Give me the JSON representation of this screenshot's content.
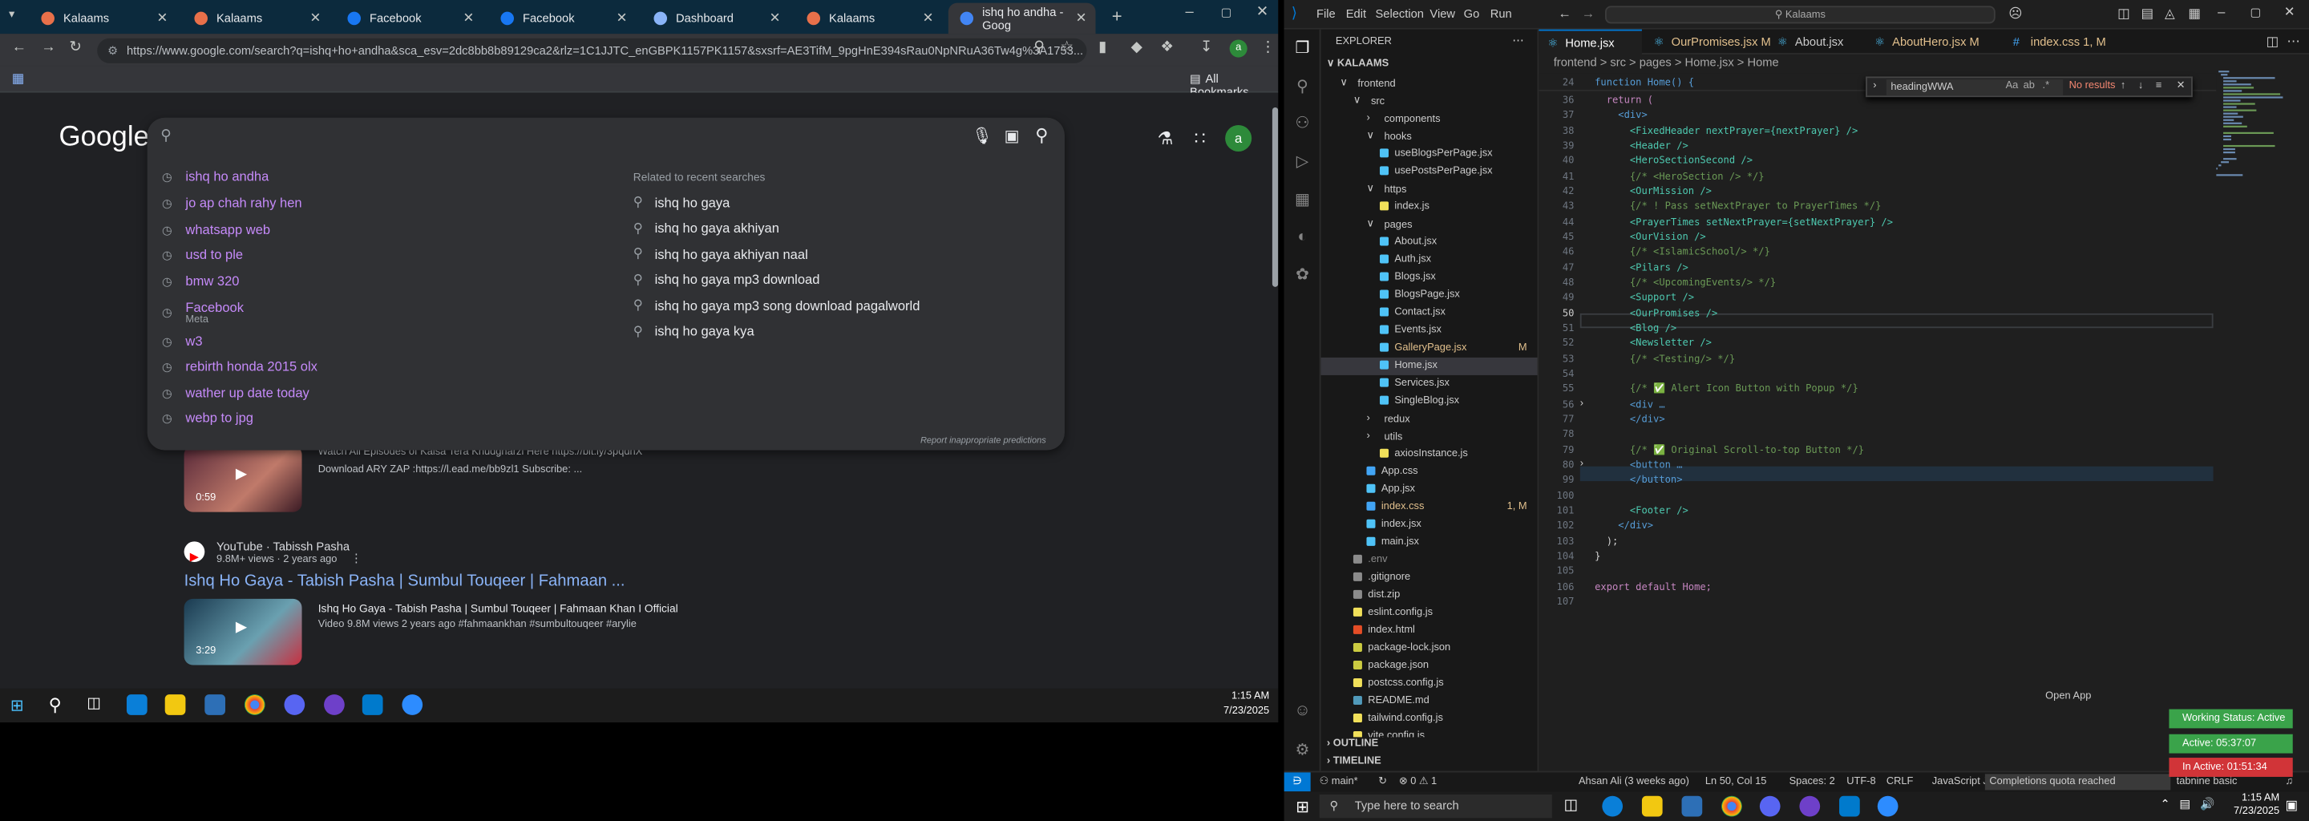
{
  "chrome": {
    "tabs": [
      {
        "title": "Kalaams",
        "icon": "kalaams-favicon-icon",
        "color": "#e8704a"
      },
      {
        "title": "Kalaams",
        "icon": "kalaams-favicon-icon",
        "color": "#e8704a"
      },
      {
        "title": "Facebook",
        "icon": "facebook-icon",
        "color": "#1877f2"
      },
      {
        "title": "Facebook",
        "icon": "facebook-icon",
        "color": "#1877f2"
      },
      {
        "title": "Dashboard",
        "icon": "globe-icon",
        "color": "#8ab4f8"
      },
      {
        "title": "Kalaams",
        "icon": "kalaams-favicon-icon",
        "color": "#e8704a"
      },
      {
        "title": "ishq ho andha - Goog",
        "icon": "google-icon",
        "color": "#4285f4"
      }
    ],
    "url": "https://www.google.com/search?q=ishq+ho+andha&sca_esv=2dc8bb8b89129ca2&rlz=1C1JJTC_enGBPK1157PK1157&sxsrf=AE3TifM_9pgHnE394sRau0NpNRuA36Tw4g%3A1753...",
    "all_bookmarks": "All Bookmarks",
    "avatar_letter": "a",
    "google_logo": "Google"
  },
  "search": {
    "suggestions": [
      {
        "text": "ishq ho andha",
        "sub": ""
      },
      {
        "text": "jo ap chah rahy hen",
        "sub": ""
      },
      {
        "text": "whatsapp web",
        "sub": ""
      },
      {
        "text": "usd to ple",
        "sub": ""
      },
      {
        "text": "bmw 320",
        "sub": ""
      },
      {
        "text": "Facebook",
        "sub": "Meta"
      },
      {
        "text": "w3",
        "sub": ""
      },
      {
        "text": "rebirth honda 2015 olx",
        "sub": ""
      },
      {
        "text": "wather up date today",
        "sub": ""
      },
      {
        "text": "webp to jpg",
        "sub": ""
      }
    ],
    "related_heading": "Related to recent searches",
    "related": [
      "ishq ho gaya",
      "ishq ho gaya akhiyan",
      "ishq ho gaya akhiyan naal",
      "ishq ho gaya mp3 download",
      "ishq ho gaya mp3 song download pagalworld",
      "ishq ho gaya kya"
    ],
    "report": "Report inappropriate predictions"
  },
  "results": {
    "partial_text": "Watch All Episodes of Kaisa Tera Khudgharzi Here  https://bit.ly/3pqdnX",
    "partial_desc": "Download ARY ZAP :https://l.ead.me/bb9zl1 Subscribe: ...",
    "duration1": "0:59",
    "source": "YouTube · Tabissh Pasha",
    "meta": "9.8M+ views · 2 years ago",
    "title": "Ishq Ho Gaya - Tabish Pasha | Sumbul Touqeer | Fahmaan ...",
    "desc": "Ishq Ho Gaya - Tabish Pasha | Sumbul Touqeer | Fahmaan Khan I Official",
    "desc2": "Video 9.8M views 2 years ago #fahmaankhan #sumbultouqeer #arylie",
    "duration2": "3:29"
  },
  "taskbar_left": {
    "time": "1:15 AM",
    "date": "7/23/2025"
  },
  "vscode": {
    "menu": [
      "File",
      "Edit",
      "Selection",
      "View",
      "Go",
      "Run"
    ],
    "search_placeholder": "Kalaams",
    "explorer_title": "EXPLORER",
    "root": "KALAAMS",
    "tree": [
      {
        "label": "frontend",
        "indent": 1,
        "type": "folder",
        "status": "",
        "color": "#cccccc"
      },
      {
        "label": "src",
        "indent": 2,
        "type": "folder",
        "status": "",
        "color": "#cccccc"
      },
      {
        "label": "components",
        "indent": 3,
        "type": "folder",
        "status": "",
        "color": "#cccccc"
      },
      {
        "label": "hooks",
        "indent": 3,
        "type": "folder",
        "status": "",
        "color": "#cccccc"
      },
      {
        "label": "useBlogsPerPage.jsx",
        "indent": 4,
        "type": "file",
        "status": "",
        "color": "#cccccc"
      },
      {
        "label": "usePostsPerPage.jsx",
        "indent": 4,
        "type": "file",
        "status": "",
        "color": "#cccccc"
      },
      {
        "label": "https",
        "indent": 3,
        "type": "folder",
        "status": "",
        "color": "#cccccc"
      },
      {
        "label": "index.js",
        "indent": 4,
        "type": "file",
        "status": "",
        "color": "#cccccc"
      },
      {
        "label": "pages",
        "indent": 3,
        "type": "folder",
        "status": "",
        "color": "#cccccc"
      },
      {
        "label": "About.jsx",
        "indent": 4,
        "type": "file",
        "status": "",
        "color": "#cccccc"
      },
      {
        "label": "Auth.jsx",
        "indent": 4,
        "type": "file",
        "status": "",
        "color": "#cccccc"
      },
      {
        "label": "Blogs.jsx",
        "indent": 4,
        "type": "file",
        "status": "",
        "color": "#cccccc"
      },
      {
        "label": "BlogsPage.jsx",
        "indent": 4,
        "type": "file",
        "status": "",
        "color": "#cccccc"
      },
      {
        "label": "Contact.jsx",
        "indent": 4,
        "type": "file",
        "status": "",
        "color": "#cccccc"
      },
      {
        "label": "Events.jsx",
        "indent": 4,
        "type": "file",
        "status": "",
        "color": "#cccccc"
      },
      {
        "label": "GalleryPage.jsx",
        "indent": 4,
        "type": "file",
        "status": "M",
        "color": "#e2c08d"
      },
      {
        "label": "Home.jsx",
        "indent": 4,
        "type": "file",
        "status": "",
        "color": "#cccccc"
      },
      {
        "label": "Services.jsx",
        "indent": 4,
        "type": "file",
        "status": "",
        "color": "#cccccc"
      },
      {
        "label": "SingleBlog.jsx",
        "indent": 4,
        "type": "file",
        "status": "",
        "color": "#cccccc"
      },
      {
        "label": "redux",
        "indent": 3,
        "type": "folder",
        "status": "",
        "color": "#cccccc"
      },
      {
        "label": "utils",
        "indent": 3,
        "type": "folder",
        "status": "",
        "color": "#cccccc"
      },
      {
        "label": "axiosInstance.js",
        "indent": 4,
        "type": "file",
        "status": "",
        "color": "#cccccc"
      },
      {
        "label": "App.css",
        "indent": 3,
        "type": "file",
        "status": "",
        "color": "#cccccc"
      },
      {
        "label": "App.jsx",
        "indent": 3,
        "type": "file",
        "status": "",
        "color": "#cccccc"
      },
      {
        "label": "index.css",
        "indent": 3,
        "type": "file",
        "status": "1, M",
        "color": "#e2c08d"
      },
      {
        "label": "index.jsx",
        "indent": 3,
        "type": "file",
        "status": "",
        "color": "#cccccc"
      },
      {
        "label": "main.jsx",
        "indent": 3,
        "type": "file",
        "status": "",
        "color": "#cccccc"
      },
      {
        "label": ".env",
        "indent": 2,
        "type": "file",
        "status": "",
        "color": "#8b8b8b"
      },
      {
        "label": ".gitignore",
        "indent": 2,
        "type": "file",
        "status": "",
        "color": "#cccccc"
      },
      {
        "label": "dist.zip",
        "indent": 2,
        "type": "file",
        "status": "",
        "color": "#cccccc"
      },
      {
        "label": "eslint.config.js",
        "indent": 2,
        "type": "file",
        "status": "",
        "color": "#cccccc"
      },
      {
        "label": "index.html",
        "indent": 2,
        "type": "file",
        "status": "",
        "color": "#cccccc"
      },
      {
        "label": "package-lock.json",
        "indent": 2,
        "type": "file",
        "status": "",
        "color": "#cccccc"
      },
      {
        "label": "package.json",
        "indent": 2,
        "type": "file",
        "status": "",
        "color": "#cccccc"
      },
      {
        "label": "postcss.config.js",
        "indent": 2,
        "type": "file",
        "status": "",
        "color": "#cccccc"
      },
      {
        "label": "README.md",
        "indent": 2,
        "type": "file",
        "status": "",
        "color": "#cccccc"
      },
      {
        "label": "tailwind.config.js",
        "indent": 2,
        "type": "file",
        "status": "",
        "color": "#cccccc"
      },
      {
        "label": "vite.config.js",
        "indent": 2,
        "type": "file",
        "status": "",
        "color": "#cccccc"
      }
    ],
    "outline": "OUTLINE",
    "timeline": "TIMELINE",
    "tabs": [
      {
        "label": "Home.jsx",
        "color": "#ffffff",
        "active": true
      },
      {
        "label": "OurPromises.jsx M",
        "color": "#e2c08d",
        "active": false
      },
      {
        "label": "About.jsx",
        "color": "#cccccc",
        "active": false
      },
      {
        "label": "AboutHero.jsx M",
        "color": "#e2c08d",
        "active": false
      },
      {
        "label": "index.css 1, M",
        "color": "#e2c08d",
        "active": false
      }
    ],
    "breadcrumb": "frontend  >  src  >  pages  >  Home.jsx  >  Home",
    "find_value": "headingWWA",
    "find_result": "No results",
    "sticky": {
      "line": "24",
      "text": "function Home() {"
    },
    "code": [
      {
        "n": "36",
        "t": "  return ("
      },
      {
        "n": "37",
        "t": "    <div>"
      },
      {
        "n": "38",
        "t": "      <FixedHeader nextPrayer={nextPrayer} />"
      },
      {
        "n": "39",
        "t": "      <Header />"
      },
      {
        "n": "40",
        "t": "      <HeroSectionSecond />"
      },
      {
        "n": "41",
        "t": "      {/* <HeroSection /> */}"
      },
      {
        "n": "42",
        "t": "      <OurMission />"
      },
      {
        "n": "43",
        "t": "      {/* ! Pass setNextPrayer to PrayerTimes */}"
      },
      {
        "n": "44",
        "t": "      <PrayerTimes setNextPrayer={setNextPrayer} />"
      },
      {
        "n": "45",
        "t": "      <OurVision />"
      },
      {
        "n": "46",
        "t": "      {/* <IslamicSchool/> */}"
      },
      {
        "n": "47",
        "t": "      <Pilars />"
      },
      {
        "n": "48",
        "t": "      {/* <UpcomingEvents/> */}"
      },
      {
        "n": "49",
        "t": "      <Support />"
      },
      {
        "n": "50",
        "t": "      <OurPromises />"
      },
      {
        "n": "51",
        "t": "      <Blog />"
      },
      {
        "n": "52",
        "t": "      <Newsletter />"
      },
      {
        "n": "53",
        "t": "      {/* <Testing/> */}"
      },
      {
        "n": "54",
        "t": ""
      },
      {
        "n": "55",
        "t": "      {/* ✅ Alert Icon Button with Popup */}"
      },
      {
        "n": "56",
        "t": "      <div …"
      },
      {
        "n": "77",
        "t": "      </div>"
      },
      {
        "n": "78",
        "t": ""
      },
      {
        "n": "79",
        "t": "      {/* ✅ Original Scroll-to-top Button */}"
      },
      {
        "n": "80",
        "t": "      <button …"
      },
      {
        "n": "99",
        "t": "      </button>"
      },
      {
        "n": "100",
        "t": ""
      },
      {
        "n": "101",
        "t": "      <Footer />"
      },
      {
        "n": "102",
        "t": "    </div>"
      },
      {
        "n": "103",
        "t": "  );"
      },
      {
        "n": "104",
        "t": "}"
      },
      {
        "n": "105",
        "t": ""
      },
      {
        "n": "106",
        "t": "export default Home;"
      },
      {
        "n": "107",
        "t": ""
      }
    ],
    "open_app": "Open App",
    "status": {
      "branch": "main*",
      "problems": "0 ⚠ 1",
      "author": "Ahsan Ali (3 weeks ago)",
      "cursor": "Ln 50, Col 15",
      "spaces": "Spaces: 2",
      "encoding": "UTF-8",
      "eol": "CRLF",
      "lang": "JavaScript JSX",
      "quota": "Completions quota reached",
      "tabnine": "tabnine basic"
    },
    "working": {
      "status": "Working Status: Active",
      "active": "Active: 05:37:07",
      "inactive": "In Active: 01:51:34"
    }
  },
  "taskbar_right": {
    "search_placeholder": "Type here to search",
    "time": "1:15 AM",
    "date": "7/23/2025"
  }
}
